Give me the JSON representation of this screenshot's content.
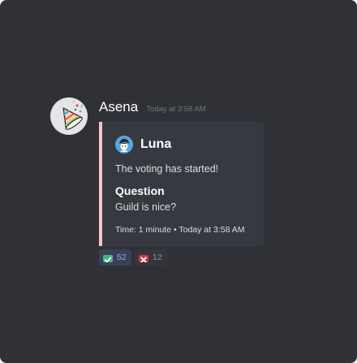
{
  "message": {
    "username": "Asena",
    "timestamp": "Today at 3:58 AM",
    "avatar_icon": "party-popper-icon"
  },
  "embed": {
    "accent_color": "#ffc0cb",
    "author": {
      "name": "Luna",
      "icon": "luna-avatar-icon"
    },
    "description": "The voting has started!",
    "field": {
      "name": "Question",
      "value": "Guild is nice?"
    },
    "footer": "Time: 1 minute • Today at 3:58 AM"
  },
  "reactions": [
    {
      "emoji": "white-check-mark-icon",
      "count": "52",
      "color": "#43b581"
    },
    {
      "emoji": "x-mark-icon",
      "count": "12",
      "color": "#dd2e44"
    }
  ],
  "colors": {
    "background": "#2f3136",
    "embed_background": "#36393f",
    "username": "#ffffff",
    "timestamp": "#72767d"
  }
}
